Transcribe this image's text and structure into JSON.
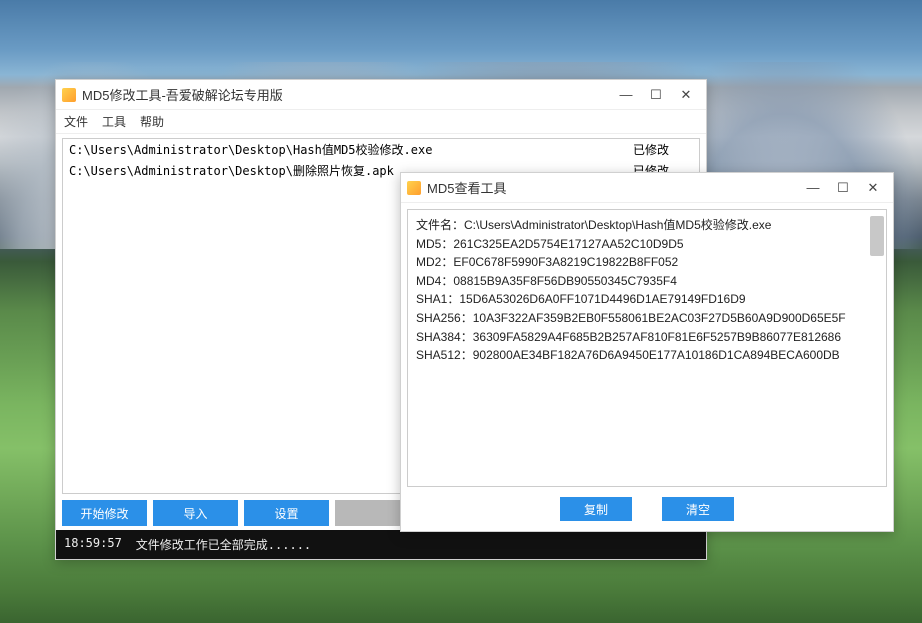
{
  "window1": {
    "title": "MD5修改工具-吾爱破解论坛专用版",
    "menu": {
      "file": "文件",
      "tools": "工具",
      "help": "帮助"
    },
    "rows": [
      {
        "path": "C:\\Users\\Administrator\\Desktop\\Hash值MD5校验修改.exe",
        "status": "已修改"
      },
      {
        "path": "C:\\Users\\Administrator\\Desktop\\删除照片恢复.apk",
        "status": "已修改"
      }
    ],
    "buttons": {
      "start": "开始修改",
      "import": "导入",
      "settings": "设置"
    },
    "status": {
      "time": "18:59:57",
      "msg": "文件修改工作已全部完成......"
    }
  },
  "window2": {
    "title": "MD5查看工具",
    "filename_label": "文件名：",
    "filename": "C:\\Users\\Administrator\\Desktop\\Hash值MD5校验修改.exe",
    "hashes": [
      {
        "algo": "MD5",
        "value": "261C325EA2D5754E17127AA52C10D9D5"
      },
      {
        "algo": "MD2",
        "value": "EF0C678F5990F3A8219C19822B8FF052"
      },
      {
        "algo": "MD4",
        "value": "08815B9A35F8F56DB90550345C7935F4"
      },
      {
        "algo": "SHA1",
        "value": "15D6A53026D6A0FF1071D4496D1AE79149FD16D9"
      },
      {
        "algo": "SHA256",
        "value": "10A3F322AF359B2EB0F558061BE2AC03F27D5B60A9D900D65E5F"
      },
      {
        "algo": "SHA384",
        "value": "36309FA5829A4F685B2B257AF810F81E6F5257B9B86077E812686"
      },
      {
        "algo": "SHA512",
        "value": "902800AE34BF182A76D6A9450E177A10186D1CA894BECA600DB"
      }
    ],
    "buttons": {
      "copy": "复制",
      "clear": "清空"
    }
  },
  "win_controls": {
    "min": "—",
    "max": "☐",
    "close": "✕"
  }
}
